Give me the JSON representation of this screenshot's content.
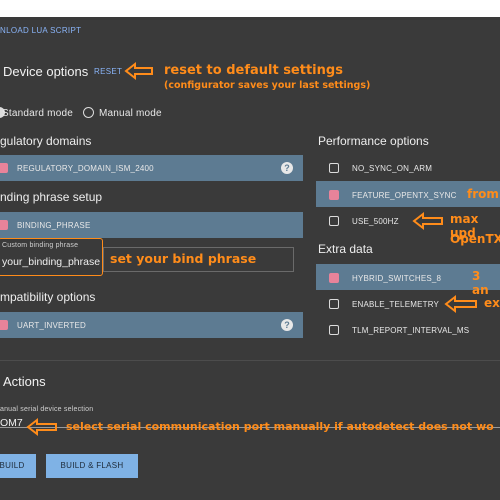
{
  "header": {
    "download_link": "NLOAD LUA SCRIPT"
  },
  "device_options": {
    "title": "Device options",
    "reset_label": "RESET",
    "note_title": "reset to default settings",
    "note_sub": "(configurator saves your last settings)"
  },
  "mode": {
    "standard": "Standard mode",
    "manual": "Manual mode"
  },
  "regulatory": {
    "title": "gulatory domains",
    "option": "REGULATORY_DOMAIN_ISM_2400"
  },
  "binding": {
    "title": "nding phrase setup",
    "option": "BINDING_PHRASE",
    "field_label": "Custom binding phrase",
    "field_value": "your_binding_phrase",
    "note": "set your bind phrase"
  },
  "compat": {
    "title": "mpatibility options",
    "option": "UART_INVERTED"
  },
  "performance": {
    "title": "Performance options",
    "options": [
      "NO_SYNC_ON_ARM",
      "FEATURE_OPENTX_SYNC",
      "USE_500HZ"
    ],
    "note_from": "from",
    "note_max": "max upd",
    "note_opentx": "OpenTX"
  },
  "extra": {
    "title": "Extra data",
    "options": [
      "HYBRID_SWITCHES_8",
      "ENABLE_TELEMETRY",
      "TLM_REPORT_INTERVAL_MS"
    ],
    "note_3a": "3 an",
    "note_ex": "ex"
  },
  "actions": {
    "title": "Actions",
    "serial_label": "anual serial device selection",
    "serial_value": "OM7",
    "serial_note": "select serial communication port manually if autodetect does not wo",
    "build": "BUILD",
    "build_flash": "BUILD & FLASH"
  },
  "colors": {
    "accent": "#ff8c1a",
    "bar": "#5d7b92",
    "checkbox_on": "#e8839a",
    "button": "#7fb2e5"
  }
}
